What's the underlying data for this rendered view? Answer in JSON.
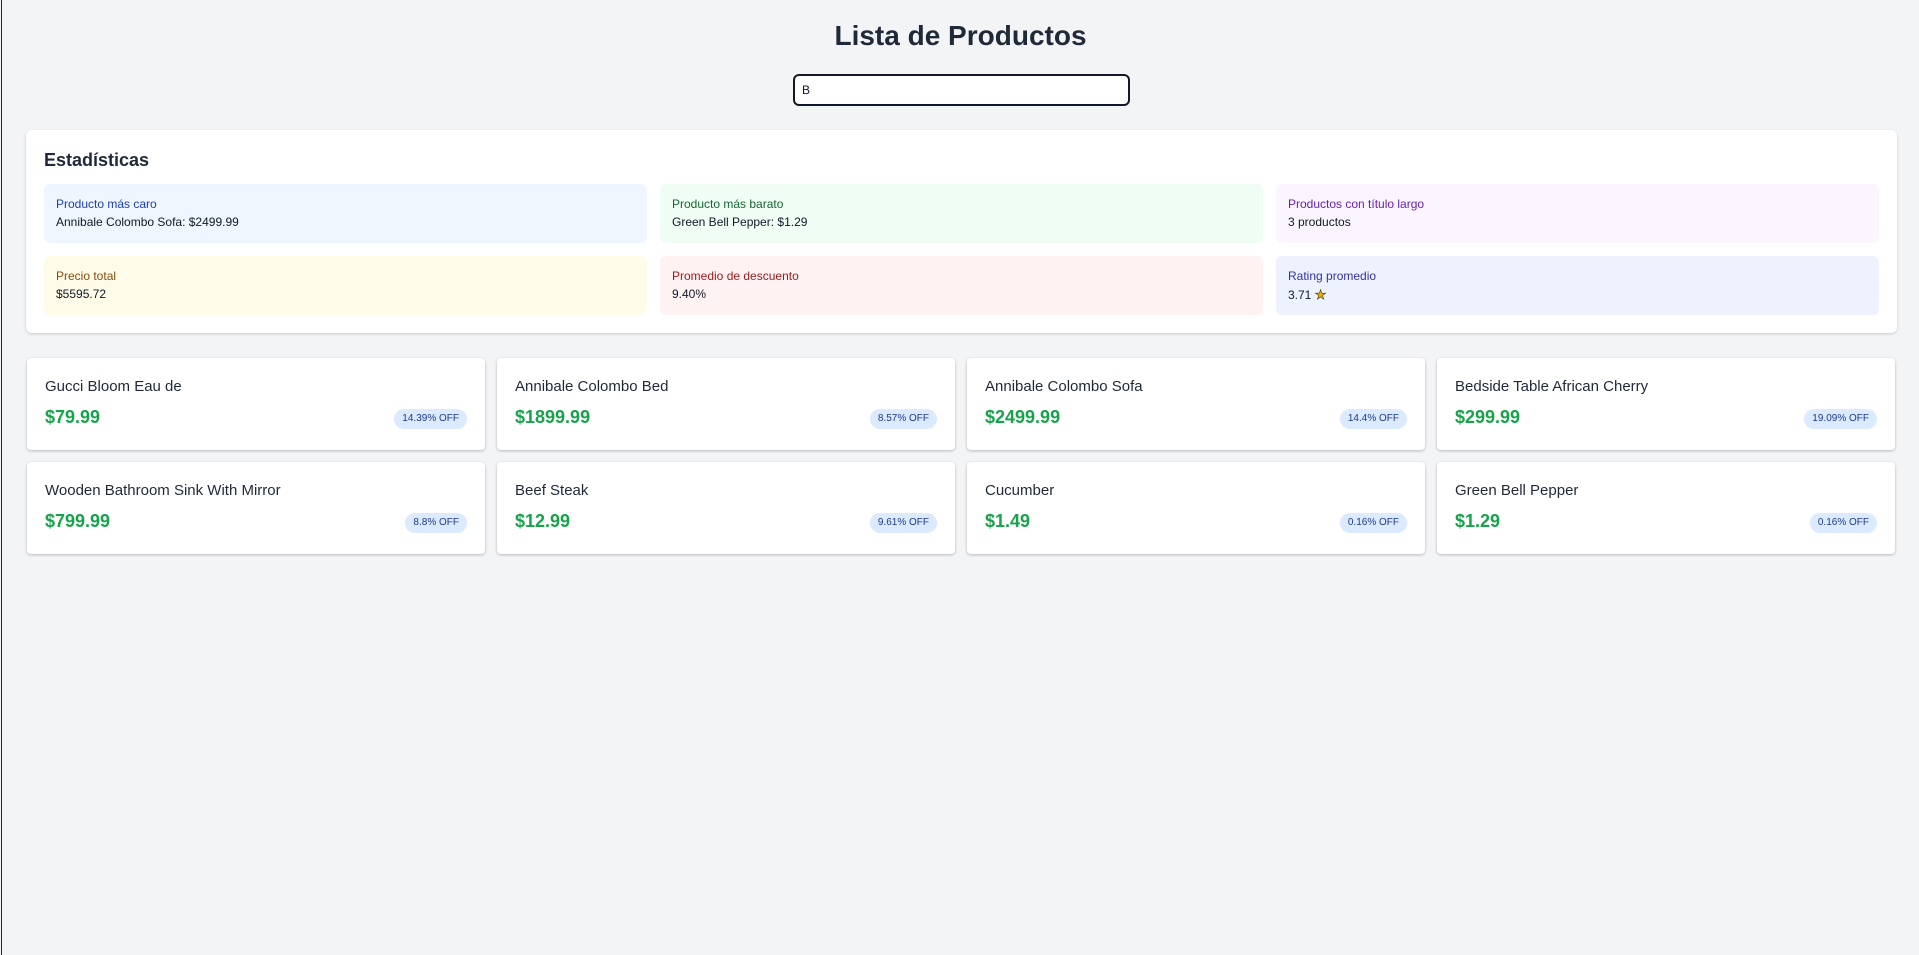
{
  "header": {
    "title": "Lista de Productos"
  },
  "search": {
    "value": "B",
    "placeholder": ""
  },
  "stats": {
    "title": "Estadísticas",
    "items": [
      {
        "label": "Producto más caro",
        "value": "Annibale Colombo Sofa: $2499.99"
      },
      {
        "label": "Producto más barato",
        "value": "Green Bell Pepper: $1.29"
      },
      {
        "label": "Productos con título largo",
        "value": "3 productos"
      },
      {
        "label": "Precio total",
        "value": "$5595.72"
      },
      {
        "label": "Promedio de descuento",
        "value": "9.40%"
      },
      {
        "label": "Rating promedio",
        "value": "3.71",
        "icon": "★"
      }
    ]
  },
  "products": [
    {
      "name": "Gucci Bloom Eau de",
      "price": "$79.99",
      "discount": "14.39% OFF"
    },
    {
      "name": "Annibale Colombo Bed",
      "price": "$1899.99",
      "discount": "8.57% OFF"
    },
    {
      "name": "Annibale Colombo Sofa",
      "price": "$2499.99",
      "discount": "14.4% OFF"
    },
    {
      "name": "Bedside Table African Cherry",
      "price": "$299.99",
      "discount": "19.09% OFF"
    },
    {
      "name": "Wooden Bathroom Sink With Mirror",
      "price": "$799.99",
      "discount": "8.8% OFF"
    },
    {
      "name": "Beef Steak",
      "price": "$12.99",
      "discount": "9.61% OFF"
    },
    {
      "name": "Cucumber",
      "price": "$1.49",
      "discount": "0.16% OFF"
    },
    {
      "name": "Green Bell Pepper",
      "price": "$1.29",
      "discount": "0.16% OFF"
    }
  ],
  "colors": {
    "price": "#16a34a",
    "badge_bg": "#dbeafe",
    "star": "#eab308"
  }
}
